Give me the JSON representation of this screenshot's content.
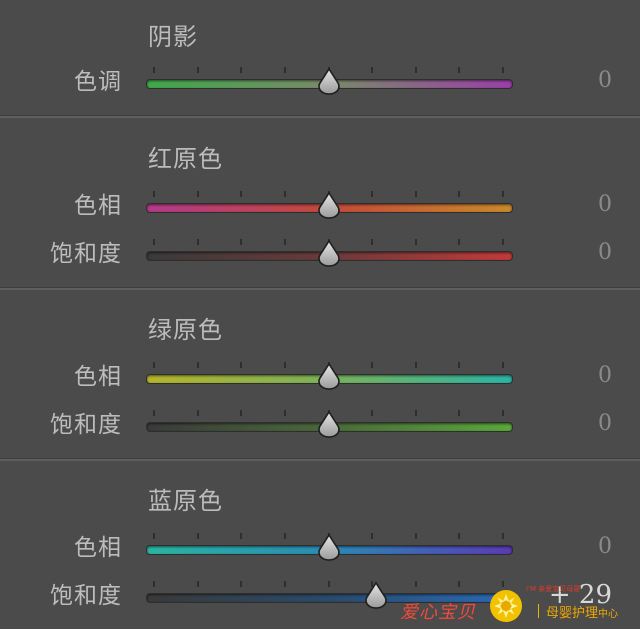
{
  "sections": [
    {
      "title": "阴影",
      "rows": [
        {
          "label": "色调",
          "value": "0",
          "position": 0.5,
          "gradient": [
            "#3fa84a",
            "#7a8a6a",
            "#9a3fa8"
          ]
        }
      ]
    },
    {
      "title": "红原色",
      "rows": [
        {
          "label": "色相",
          "value": "0",
          "position": 0.5,
          "gradient": [
            "#b23a8a",
            "#c24a3a",
            "#c98a2a"
          ]
        },
        {
          "label": "饱和度",
          "value": "0",
          "position": 0.5,
          "gradient": [
            "#3a3a3a",
            "#6a3a3a",
            "#c23a3a"
          ]
        }
      ]
    },
    {
      "title": "绿原色",
      "rows": [
        {
          "label": "色相",
          "value": "0",
          "position": 0.5,
          "gradient": [
            "#b5b52a",
            "#7ab25a",
            "#2ab5a5"
          ]
        },
        {
          "label": "饱和度",
          "value": "0",
          "position": 0.5,
          "gradient": [
            "#3a3a3a",
            "#4a6a3a",
            "#5aa83a"
          ]
        }
      ]
    },
    {
      "title": "蓝原色",
      "rows": [
        {
          "label": "色相",
          "value": "0",
          "position": 0.5,
          "gradient": [
            "#2ab5a0",
            "#2a8ab5",
            "#5a3ab5"
          ]
        },
        {
          "label": "饱和度",
          "value": "+ 29",
          "position": 0.63,
          "gradient": [
            "#3a3a3a",
            "#2a4a6a",
            "#2a6ab5"
          ]
        }
      ]
    }
  ],
  "watermark": {
    "left_text": "爱心宝贝",
    "small_text": "I'M 亲爱宝贝母婴",
    "right_text": "母婴护理",
    "right_small": "中心"
  }
}
